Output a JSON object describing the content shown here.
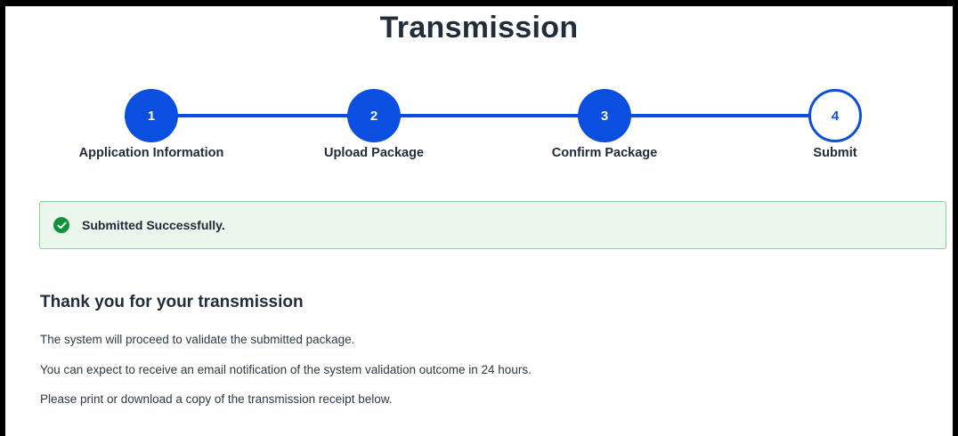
{
  "page": {
    "title": "Transmission"
  },
  "stepper": {
    "steps": [
      {
        "number": "1",
        "label": "Application Information",
        "state": "complete"
      },
      {
        "number": "2",
        "label": "Upload Package",
        "state": "complete"
      },
      {
        "number": "3",
        "label": "Confirm Package",
        "state": "complete"
      },
      {
        "number": "4",
        "label": "Submit",
        "state": "current"
      }
    ]
  },
  "alert": {
    "icon": "check-circle-icon",
    "message": "Submitted Successfully.",
    "color": "#11923a"
  },
  "content": {
    "heading": "Thank you for your transmission",
    "paragraphs": [
      "The system will proceed to validate the submitted package.",
      "You can expect to receive an email notification of the system validation outcome in 24 hours.",
      "Please print or download a copy of the transmission receipt below."
    ]
  },
  "colors": {
    "accent": "#0a4fe0",
    "success_bg": "#ebf6ec",
    "success_border": "#8fce98"
  }
}
